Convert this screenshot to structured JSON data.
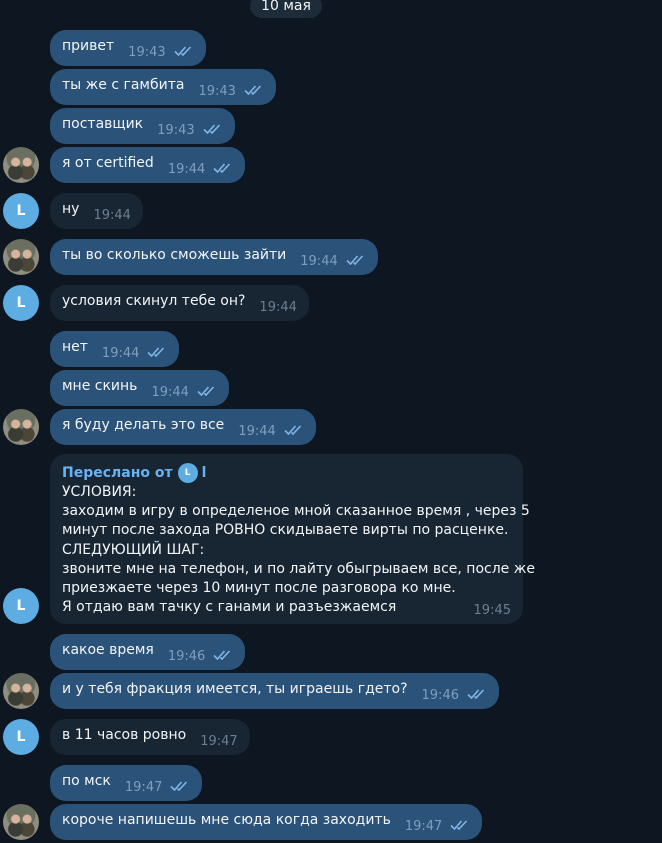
{
  "chat": {
    "date": "10 мая",
    "forward": {
      "header": "Переслано от",
      "sender_initial": "L",
      "sender_name": "l",
      "lines": [
        "УСЛОВИЯ:",
        "заходим в игру в определеное мной сказанное время , через 5",
        "минут после захода РОВНО скидываете вирты по расценке.",
        "СЛЕДУЮЩИЙ ШАГ:",
        "звоните мне на телефон, и по лайту обыгрываем все, после же",
        "приезжаете через 10 минут после разговора ко мне.",
        "Я отдаю вам тачку с ганами и разъезжаемся"
      ],
      "time": "19:45"
    },
    "avatar_letter": "L",
    "messages": [
      {
        "text": "привет",
        "time": "19:43"
      },
      {
        "text": "ты же с гамбита",
        "time": "19:43"
      },
      {
        "text": "поставщик",
        "time": "19:43"
      },
      {
        "text": "я от certified",
        "time": "19:44"
      },
      {
        "text": "ну",
        "time": "19:44"
      },
      {
        "text": "ты во сколько сможешь зайти",
        "time": "19:44"
      },
      {
        "text": "условия скинул тебе он?",
        "time": "19:44"
      },
      {
        "text": "нет",
        "time": "19:44"
      },
      {
        "text": "мне скинь",
        "time": "19:44"
      },
      {
        "text": "я буду делать это все",
        "time": "19:44"
      },
      {
        "text": "какое время",
        "time": "19:46"
      },
      {
        "text": "и у тебя фракция имеется, ты играешь гдето?",
        "time": "19:46"
      },
      {
        "text": "в 11 часов ровно",
        "time": "19:47"
      },
      {
        "text": "по мск",
        "time": "19:47"
      },
      {
        "text": "короче напишешь мне сюда когда заходить",
        "time": "19:47"
      }
    ]
  }
}
